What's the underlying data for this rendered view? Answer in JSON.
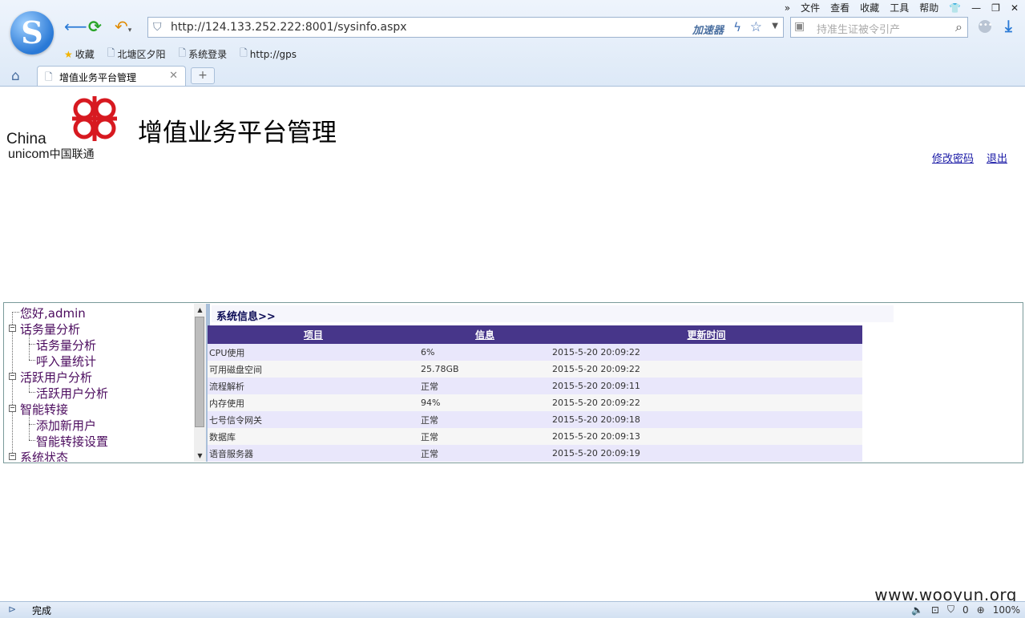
{
  "browser": {
    "menu": [
      "文件",
      "查看",
      "收藏",
      "工具",
      "帮助"
    ],
    "url": "http://124.133.252.222:8001/sysinfo.aspx",
    "accelerator_label": "加速器",
    "search_placeholder": "持准生证被令引产",
    "favorites": [
      {
        "label": "收藏",
        "icon": "star-icon"
      },
      {
        "label": "北塘区夕阳",
        "icon": "page-icon"
      },
      {
        "label": "系统登录",
        "icon": "page-icon"
      },
      {
        "label": "http://gps",
        "icon": "page-icon"
      }
    ],
    "tab_title": "增值业务平台管理",
    "new_tab": "+"
  },
  "header": {
    "brand_en_1": "China",
    "brand_en_2": "unicom",
    "brand_cn": "中国联通",
    "title": "增值业务平台管理",
    "links": {
      "change_password": "修改密码",
      "logout": "退出"
    }
  },
  "tree": {
    "greeting": "您好,admin",
    "groups": [
      {
        "label": "话务量分析",
        "children": [
          "话务量分析",
          "呼入量统计"
        ]
      },
      {
        "label": "活跃用户分析",
        "children": [
          "活跃用户分析"
        ]
      },
      {
        "label": "智能转接",
        "children": [
          "添加新用户",
          "智能转接设置"
        ]
      },
      {
        "label": "系统状态",
        "children": []
      }
    ]
  },
  "info": {
    "heading": "系统信息>>",
    "columns": [
      "项目",
      "信息",
      "更新时间"
    ],
    "rows": [
      [
        "CPU使用",
        "6%",
        "2015-5-20 20:09:22"
      ],
      [
        "可用磁盘空间",
        "25.78GB",
        "2015-5-20 20:09:22"
      ],
      [
        "流程解析",
        "正常",
        "2015-5-20 20:09:11"
      ],
      [
        "内存使用",
        "94%",
        "2015-5-20 20:09:22"
      ],
      [
        "七号信令网关",
        "正常",
        "2015-5-20 20:09:18"
      ],
      [
        "数据库",
        "正常",
        "2015-5-20 20:09:13"
      ],
      [
        "语音服务器",
        "正常",
        "2015-5-20 20:09:19"
      ]
    ]
  },
  "status": {
    "text": "完成",
    "counter": "0",
    "zoom": "100%"
  },
  "watermark": "www.wooyun.org",
  "colors": {
    "table_header": "#47368a",
    "row_odd": "#e9e7fb",
    "row_even": "#f6f6f6",
    "tree_text": "#4b0b5e",
    "link": "#1a1aa6",
    "brand_red": "#d71920"
  }
}
